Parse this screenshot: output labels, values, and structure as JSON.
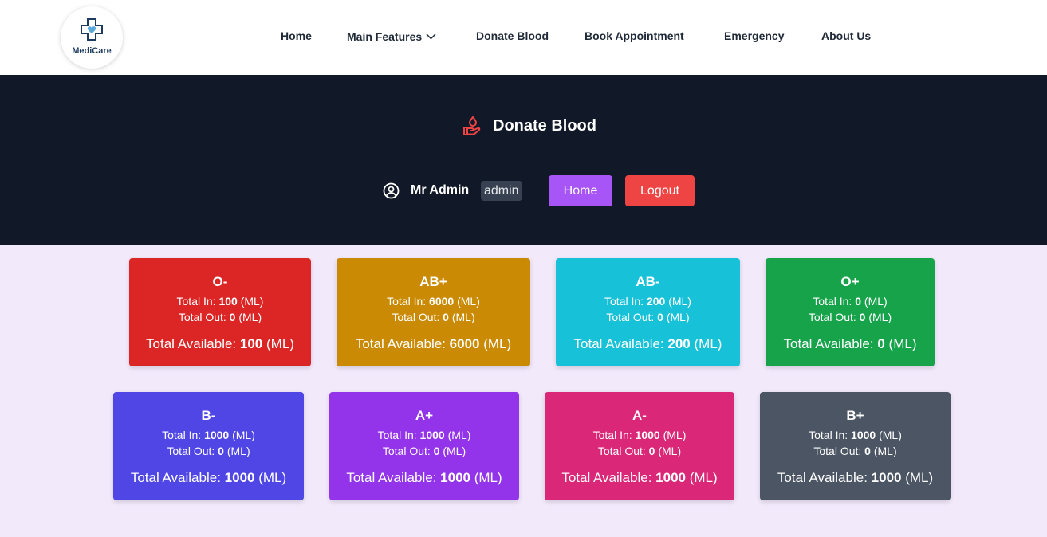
{
  "logo": {
    "text": "MediCare"
  },
  "nav": {
    "items": [
      {
        "label": "Home"
      },
      {
        "label": "Main Features"
      },
      {
        "label": "Donate Blood"
      },
      {
        "label": "Book Appointment"
      },
      {
        "label": "Emergency"
      },
      {
        "label": "About Us"
      }
    ]
  },
  "hero": {
    "title": "Donate Blood",
    "icon": "hand-heart-icon",
    "user": {
      "name": "Mr Admin",
      "role": "admin"
    },
    "home_button": "Home",
    "logout_button": "Logout"
  },
  "labels": {
    "total_in": "Total In:",
    "total_out": "Total Out:",
    "total_available": "Total Available:",
    "unit": "(ML)"
  },
  "blood_groups": [
    {
      "group": "O-",
      "in": "100",
      "out": "0",
      "available": "100",
      "color": "#dc2626"
    },
    {
      "group": "AB+",
      "in": "6000",
      "out": "0",
      "available": "6000",
      "color": "#ca8a04"
    },
    {
      "group": "AB-",
      "in": "200",
      "out": "0",
      "available": "200",
      "color": "#17c1d8"
    },
    {
      "group": "O+",
      "in": "0",
      "out": "0",
      "available": "0",
      "color": "#16a34a"
    },
    {
      "group": "B-",
      "in": "1000",
      "out": "0",
      "available": "1000",
      "color": "#4f46e5"
    },
    {
      "group": "A+",
      "in": "1000",
      "out": "0",
      "available": "1000",
      "color": "#9333ea"
    },
    {
      "group": "A-",
      "in": "1000",
      "out": "0",
      "available": "1000",
      "color": "#db2777"
    },
    {
      "group": "B+",
      "in": "1000",
      "out": "0",
      "available": "1000",
      "color": "#4b5563"
    }
  ],
  "colors": {
    "navbar_bg": "#ffffff",
    "hero_bg": "#111827",
    "page_bg": "#f2e9fb",
    "accent_red": "#ef4444",
    "accent_purple": "#a855f7"
  }
}
